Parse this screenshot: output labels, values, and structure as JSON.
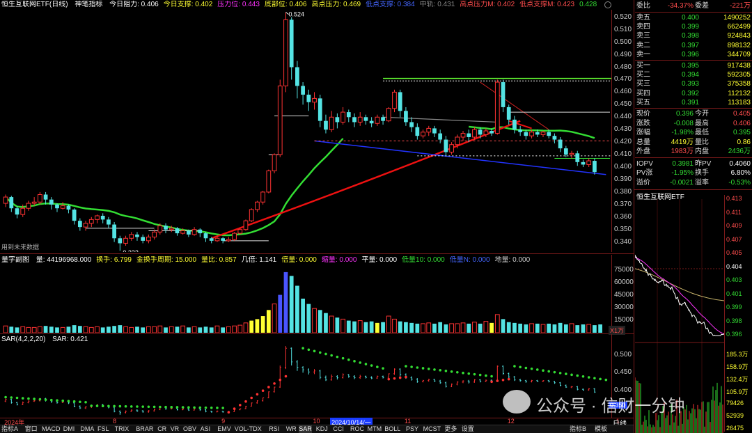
{
  "header": {
    "title": "恒生互联网ETF(日线)",
    "indicator": "神笔指标",
    "items": [
      {
        "t": "今日阻力: 0.406",
        "c": "#ffffff"
      },
      {
        "t": "今日支撑: 0.402",
        "c": "#ffff33"
      },
      {
        "t": "压力位: 0.443",
        "c": "#ff33ff"
      },
      {
        "t": "底部位: 0.406",
        "c": "#ffff33"
      },
      {
        "t": "高点压力: 0.469",
        "c": "#ffff33"
      },
      {
        "t": "低点支撑: 0.384",
        "c": "#4466ff"
      },
      {
        "t": "中轨: 0.431",
        "c": "#888888"
      },
      {
        "t": "高点压力M: 0.402",
        "c": "#ff4d4d"
      },
      {
        "t": "低点支撑M: 0.423",
        "c": "#ff4d4d"
      },
      {
        "t": "0.428",
        "c": "#33dd33"
      }
    ]
  },
  "price_chart": {
    "high_label": "0.524",
    "low_label": "0.333",
    "note": "用到未来数据",
    "y_ticks": [
      "0.520",
      "0.510",
      "0.500",
      "0.490",
      "0.480",
      "0.470",
      "0.460",
      "0.450",
      "0.440",
      "0.430",
      "0.420",
      "0.410",
      "0.400",
      "0.390",
      "0.380",
      "0.370",
      "0.360",
      "0.350",
      "0.340"
    ],
    "ylim": [
      0.332,
      0.526
    ],
    "candles": [
      [
        0.371,
        0.376,
        0.378,
        0.368
      ],
      [
        0.376,
        0.367,
        0.377,
        0.364
      ],
      [
        0.367,
        0.362,
        0.369,
        0.359
      ],
      [
        0.362,
        0.367,
        0.37,
        0.36
      ],
      [
        0.367,
        0.371,
        0.373,
        0.365
      ],
      [
        0.371,
        0.372,
        0.376,
        0.369
      ],
      [
        0.372,
        0.378,
        0.38,
        0.37
      ],
      [
        0.378,
        0.374,
        0.38,
        0.37
      ],
      [
        0.374,
        0.37,
        0.376,
        0.366
      ],
      [
        0.37,
        0.367,
        0.371,
        0.364
      ],
      [
        0.367,
        0.369,
        0.372,
        0.366
      ],
      [
        0.369,
        0.366,
        0.37,
        0.363
      ],
      [
        0.366,
        0.357,
        0.367,
        0.354
      ],
      [
        0.357,
        0.352,
        0.359,
        0.349
      ],
      [
        0.352,
        0.355,
        0.357,
        0.349
      ],
      [
        0.355,
        0.358,
        0.36,
        0.352
      ],
      [
        0.358,
        0.361,
        0.362,
        0.355
      ],
      [
        0.361,
        0.358,
        0.363,
        0.355
      ],
      [
        0.358,
        0.354,
        0.36,
        0.351
      ],
      [
        0.354,
        0.343,
        0.356,
        0.34
      ],
      [
        0.343,
        0.339,
        0.345,
        0.333
      ],
      [
        0.339,
        0.343,
        0.345,
        0.337
      ],
      [
        0.343,
        0.346,
        0.348,
        0.341
      ],
      [
        0.346,
        0.344,
        0.348,
        0.341
      ],
      [
        0.344,
        0.341,
        0.346,
        0.339
      ],
      [
        0.341,
        0.344,
        0.346,
        0.339
      ],
      [
        0.344,
        0.348,
        0.35,
        0.342
      ],
      [
        0.348,
        0.353,
        0.355,
        0.346
      ],
      [
        0.353,
        0.35,
        0.355,
        0.347
      ],
      [
        0.35,
        0.351,
        0.353,
        0.348
      ],
      [
        0.351,
        0.347,
        0.352,
        0.345
      ],
      [
        0.347,
        0.349,
        0.351,
        0.346
      ],
      [
        0.349,
        0.346,
        0.35,
        0.344
      ],
      [
        0.346,
        0.35,
        0.352,
        0.345
      ],
      [
        0.35,
        0.347,
        0.351,
        0.344
      ],
      [
        0.347,
        0.343,
        0.348,
        0.34
      ],
      [
        0.343,
        0.341,
        0.344,
        0.339
      ],
      [
        0.341,
        0.343,
        0.345,
        0.34
      ],
      [
        0.343,
        0.341,
        0.344,
        0.339
      ],
      [
        0.341,
        0.342,
        0.344,
        0.34
      ],
      [
        0.342,
        0.347,
        0.348,
        0.341
      ],
      [
        0.347,
        0.35,
        0.351,
        0.346
      ],
      [
        0.35,
        0.357,
        0.358,
        0.349
      ],
      [
        0.357,
        0.366,
        0.367,
        0.356
      ],
      [
        0.366,
        0.372,
        0.373,
        0.364
      ],
      [
        0.372,
        0.38,
        0.381,
        0.37
      ],
      [
        0.38,
        0.397,
        0.398,
        0.379
      ],
      [
        0.397,
        0.41,
        0.411,
        0.395
      ],
      [
        0.41,
        0.465,
        0.47,
        0.408
      ],
      [
        0.465,
        0.518,
        0.524,
        0.46
      ],
      [
        0.518,
        0.48,
        0.52,
        0.47
      ],
      [
        0.48,
        0.465,
        0.485,
        0.455
      ],
      [
        0.465,
        0.458,
        0.468,
        0.45
      ],
      [
        0.458,
        0.452,
        0.462,
        0.445
      ],
      [
        0.452,
        0.455,
        0.46,
        0.446
      ],
      [
        0.455,
        0.437,
        0.458,
        0.432
      ],
      [
        0.437,
        0.43,
        0.442,
        0.427
      ],
      [
        0.43,
        0.44,
        0.445,
        0.428
      ],
      [
        0.44,
        0.436,
        0.443,
        0.431
      ],
      [
        0.436,
        0.444,
        0.448,
        0.434
      ],
      [
        0.444,
        0.44,
        0.446,
        0.436
      ],
      [
        0.44,
        0.436,
        0.443,
        0.432
      ],
      [
        0.436,
        0.44,
        0.444,
        0.433
      ],
      [
        0.44,
        0.437,
        0.442,
        0.434
      ],
      [
        0.437,
        0.435,
        0.44,
        0.432
      ],
      [
        0.435,
        0.44,
        0.442,
        0.433
      ],
      [
        0.44,
        0.437,
        0.442,
        0.434
      ],
      [
        0.437,
        0.447,
        0.448,
        0.436
      ],
      [
        0.447,
        0.46,
        0.462,
        0.444
      ],
      [
        0.46,
        0.445,
        0.462,
        0.44
      ],
      [
        0.445,
        0.436,
        0.448,
        0.433
      ],
      [
        0.436,
        0.432,
        0.44,
        0.428
      ],
      [
        0.432,
        0.425,
        0.435,
        0.422
      ],
      [
        0.425,
        0.428,
        0.43,
        0.423
      ],
      [
        0.428,
        0.431,
        0.433,
        0.425
      ],
      [
        0.431,
        0.427,
        0.433,
        0.424
      ],
      [
        0.427,
        0.422,
        0.43,
        0.419
      ],
      [
        0.422,
        0.412,
        0.425,
        0.409
      ],
      [
        0.412,
        0.418,
        0.42,
        0.41
      ],
      [
        0.418,
        0.424,
        0.426,
        0.415
      ],
      [
        0.424,
        0.427,
        0.429,
        0.421
      ],
      [
        0.427,
        0.424,
        0.43,
        0.42
      ],
      [
        0.424,
        0.43,
        0.432,
        0.422
      ],
      [
        0.43,
        0.426,
        0.432,
        0.423
      ],
      [
        0.426,
        0.429,
        0.431,
        0.424
      ],
      [
        0.429,
        0.427,
        0.431,
        0.425
      ],
      [
        0.427,
        0.468,
        0.47,
        0.426
      ],
      [
        0.468,
        0.448,
        0.47,
        0.444
      ],
      [
        0.448,
        0.438,
        0.45,
        0.434
      ],
      [
        0.438,
        0.43,
        0.441,
        0.427
      ],
      [
        0.43,
        0.428,
        0.433,
        0.425
      ],
      [
        0.428,
        0.425,
        0.43,
        0.422
      ],
      [
        0.425,
        0.428,
        0.43,
        0.423
      ],
      [
        0.428,
        0.426,
        0.43,
        0.424
      ],
      [
        0.426,
        0.428,
        0.429,
        0.424
      ],
      [
        0.428,
        0.425,
        0.43,
        0.423
      ],
      [
        0.425,
        0.422,
        0.427,
        0.419
      ],
      [
        0.422,
        0.415,
        0.424,
        0.412
      ],
      [
        0.415,
        0.41,
        0.417,
        0.408
      ],
      [
        0.41,
        0.411,
        0.413,
        0.407
      ],
      [
        0.411,
        0.404,
        0.413,
        0.401
      ],
      [
        0.404,
        0.402,
        0.406,
        0.4
      ],
      [
        0.402,
        0.405,
        0.407,
        0.4
      ],
      [
        0.405,
        0.396,
        0.407,
        0.394
      ]
    ]
  },
  "volume_header": {
    "title": "量字副图",
    "items": [
      {
        "t": "量: 44196968.000",
        "c": "#ffffff"
      },
      {
        "t": "换手: 6.799",
        "c": "#ffff33"
      },
      {
        "t": "金换手周期: 15.000",
        "c": "#ffff33"
      },
      {
        "t": "量比: 0.857",
        "c": "#ffff33"
      },
      {
        "t": "几倍: 1.141",
        "c": "#ffffff"
      },
      {
        "t": "倍量: 0.000",
        "c": "#ffff33"
      },
      {
        "t": "缩量: 0.000",
        "c": "#ff33ff"
      },
      {
        "t": "平量: 0.000",
        "c": "#ffffff"
      },
      {
        "t": "低量10: 0.000",
        "c": "#33dd33"
      },
      {
        "t": "低量N: 0.000",
        "c": "#4466ff"
      },
      {
        "t": "地量: 0.000",
        "c": "#cccccc"
      }
    ],
    "y_ticks": [
      "75000",
      "60000",
      "45000",
      "30000",
      "15000"
    ],
    "unit": "X1万",
    "values": [
      9,
      8,
      7,
      8,
      7,
      7,
      8,
      9,
      8,
      7,
      7,
      8,
      10,
      9,
      8,
      7,
      8,
      7,
      8,
      9,
      10,
      8,
      7,
      8,
      7,
      8,
      8,
      9,
      7,
      8,
      8,
      9,
      7,
      8,
      7,
      8,
      7,
      9,
      7,
      8,
      9,
      10,
      13,
      16,
      18,
      22,
      30,
      38,
      50,
      80,
      75,
      62,
      45,
      38,
      32,
      30,
      26,
      22,
      20,
      18,
      16,
      15,
      16,
      14,
      15,
      13,
      14,
      22,
      18,
      15,
      14,
      13,
      12,
      12,
      13,
      12,
      14,
      11,
      12,
      12,
      13,
      12,
      14,
      12,
      15,
      13,
      24,
      18,
      14,
      13,
      12,
      11,
      12,
      12,
      11,
      12,
      11,
      13,
      11,
      12,
      10,
      11,
      11,
      10,
      11
    ],
    "vmax": 90
  },
  "sar_header": {
    "title": "SAR(4,2,2,20)",
    "value": "SAR: 0.421",
    "y_ticks": [
      "0.500",
      "0.450",
      "0.400"
    ],
    "left_marker": "0.350"
  },
  "x_axis": {
    "labels": [
      {
        "t": "2024年",
        "i": 0,
        "c": "#ff4d4d"
      },
      {
        "t": "8",
        "i": 19,
        "c": "#ff4d4d"
      },
      {
        "t": "9",
        "i": 38,
        "c": "#ff4d4d"
      },
      {
        "t": "10",
        "i": 54,
        "c": "#ff4d4d"
      },
      {
        "t": "2024/10/14/一",
        "i": 57,
        "c": "#ffffff",
        "bg": "#1a3cff"
      },
      {
        "t": "11",
        "i": 70,
        "c": "#ff4d4d"
      },
      {
        "t": "12",
        "i": 88,
        "c": "#ff4d4d"
      },
      {
        "t": "1",
        "i": 107,
        "c": "#ff4d4d"
      }
    ]
  },
  "bottom_tabs": [
    "指标A",
    "窗口",
    "MACD",
    "DMI",
    "DMA",
    "FSL",
    "TRIX",
    "BRAR",
    "CR",
    "VR",
    "OBV",
    "ASI",
    "EMV",
    "VOL-TDX",
    "RSI",
    "WR",
    "SAR",
    "KDJ",
    "CCI",
    "ROC",
    "MTM",
    "BOLL",
    "PSY",
    "MCST",
    "更多",
    "设置"
  ],
  "bottom_right_tabs": [
    "指标B",
    "模板"
  ],
  "period_label": "日线",
  "order_book": {
    "top": {
      "l1": "委比",
      "v1": "-34.37%",
      "l2": "委差",
      "v2": "-221万"
    },
    "sell": [
      {
        "label": "卖五",
        "price": "0.400",
        "vol": "1490252"
      },
      {
        "label": "卖四",
        "price": "0.399",
        "vol": "662499"
      },
      {
        "label": "卖三",
        "price": "0.398",
        "vol": "924843"
      },
      {
        "label": "卖二",
        "price": "0.397",
        "vol": "898132"
      },
      {
        "label": "卖一",
        "price": "0.396",
        "vol": "344709"
      }
    ],
    "buy": [
      {
        "label": "买一",
        "price": "0.395",
        "vol": "917438"
      },
      {
        "label": "买二",
        "price": "0.394",
        "vol": "592305"
      },
      {
        "label": "买三",
        "price": "0.393",
        "vol": "375358"
      },
      {
        "label": "买四",
        "price": "0.392",
        "vol": "112132"
      },
      {
        "label": "买五",
        "price": "0.391",
        "vol": "113183"
      }
    ]
  },
  "stats": [
    {
      "l1": "现价",
      "v1": "0.396",
      "c1": "#33dd33",
      "l2": "今开",
      "v2": "0.405",
      "c2": "#ff4d4d"
    },
    {
      "l1": "涨跌",
      "v1": "-0.008",
      "c1": "#33dd33",
      "l2": "最高",
      "v2": "0.406",
      "c2": "#ff4d4d"
    },
    {
      "l1": "涨幅",
      "v1": "-1.98%",
      "c1": "#33dd33",
      "l2": "最低",
      "v2": "0.395",
      "c2": "#33dd33"
    },
    {
      "l1": "总量",
      "v1": "4419万",
      "c1": "#ffff33",
      "l2": "量比",
      "v2": "0.86",
      "c2": "#ffff33"
    },
    {
      "l1": "外盘",
      "v1": "1983万",
      "c1": "#ff4d4d",
      "l2": "内盘",
      "v2": "2436万",
      "c2": "#33dd33"
    },
    {
      "l1": "IOPV",
      "v1": "0.3981",
      "c1": "#33dd33",
      "l2": "昨PV",
      "v2": "0.4060",
      "c2": "#ffffff"
    },
    {
      "l1": "PV涨",
      "v1": "-1.95%",
      "c1": "#33dd33",
      "l2": "换手",
      "v2": "6.80%",
      "c2": "#ffffff"
    },
    {
      "l1": "溢价",
      "v1": "-0.0021",
      "c1": "#33dd33",
      "l2": "溢率",
      "v2": "-0.53%",
      "c2": "#33dd33"
    }
  ],
  "intraday": {
    "title": "恒生互联网ETF",
    "left_ticks": [
      "0.413",
      "0.411",
      "0.409",
      "0.407",
      "0.405",
      "0.404",
      "0.403",
      "0.401",
      "0.399",
      "0.398",
      "0.396"
    ],
    "right_ticks": [
      "2.47%",
      "1.98%",
      "1.48%",
      "0.99%",
      "0.49%",
      "0.00%",
      "0.49%",
      "0.99%",
      "1.48%",
      "1.98%",
      "2.47%"
    ],
    "vol_ticks": [
      "185.3万",
      "158.9万",
      "132.4万",
      "105.9万",
      "79426",
      "52939",
      "26475"
    ]
  },
  "watermark": "公众号 · 信财一分钟"
}
